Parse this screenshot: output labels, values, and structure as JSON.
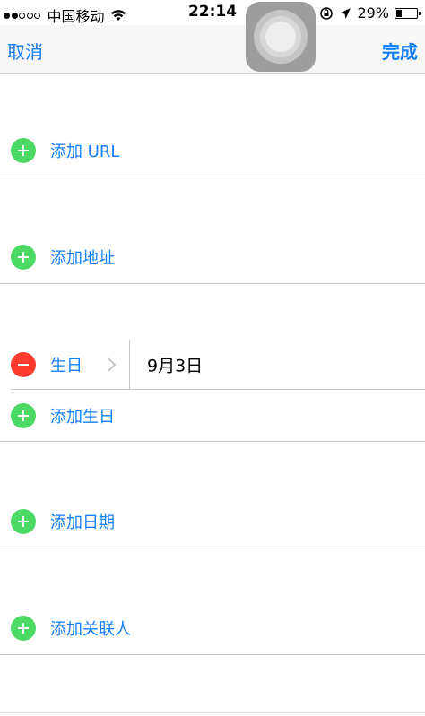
{
  "status_bar": {
    "carrier": "中国移动",
    "time": "22:14",
    "battery_percent": "29%",
    "battery_level": 0.29,
    "signal_strength": 2,
    "signal_max": 5
  },
  "nav": {
    "cancel_label": "取消",
    "done_label": "完成"
  },
  "rows": {
    "add_url": "添加 URL",
    "add_address": "添加地址",
    "birthday_label": "生日",
    "birthday_value": "9月3日",
    "add_birthday": "添加生日",
    "add_date": "添加日期",
    "add_related": "添加关联人"
  },
  "colors": {
    "accent": "#147efb",
    "add_green": "#4cd964",
    "remove_red": "#ff3b30"
  },
  "icons": {
    "add": "plus-circle-icon",
    "remove": "minus-circle-icon",
    "chevron": "chevron-right-icon",
    "wifi": "wifi-icon",
    "location": "location-arrow-icon",
    "orientation_lock": "orientation-lock-icon",
    "battery": "battery-icon",
    "assistive": "assistive-touch-icon"
  }
}
